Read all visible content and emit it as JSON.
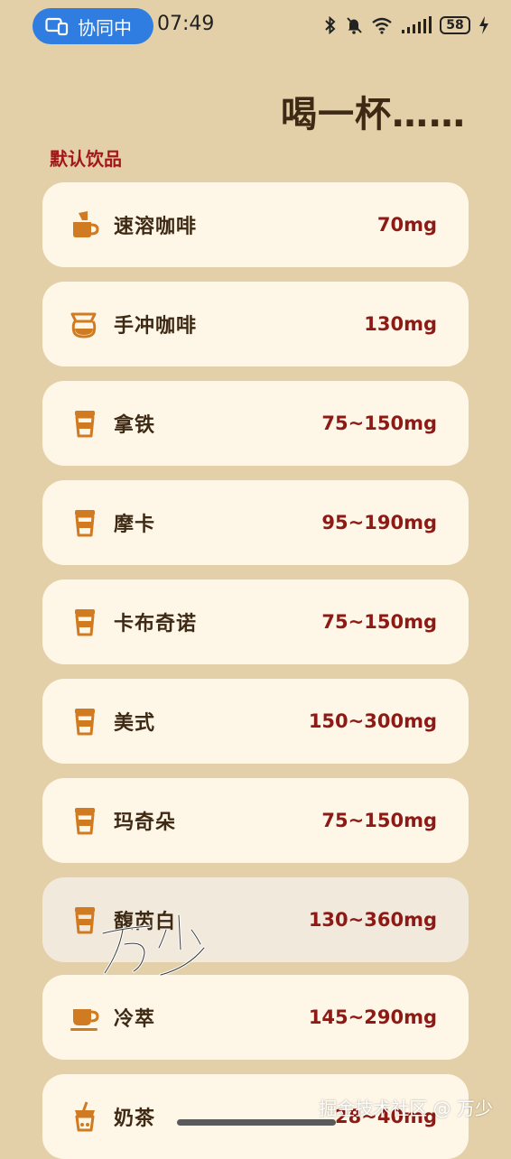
{
  "status_bar": {
    "collab_label": "协同中",
    "time": "07:49",
    "battery": "58"
  },
  "header": {
    "title": "喝一杯……",
    "section_label": "默认饮品"
  },
  "drinks": [
    {
      "name": "速溶咖啡",
      "caffeine": "70mg",
      "icon": "instant-coffee-icon"
    },
    {
      "name": "手冲咖啡",
      "caffeine": "130mg",
      "icon": "pour-over-icon"
    },
    {
      "name": "拿铁",
      "caffeine": "75~150mg",
      "icon": "coffee-cup-icon"
    },
    {
      "name": "摩卡",
      "caffeine": "95~190mg",
      "icon": "coffee-cup-icon"
    },
    {
      "name": "卡布奇诺",
      "caffeine": "75~150mg",
      "icon": "coffee-cup-icon"
    },
    {
      "name": "美式",
      "caffeine": "150~300mg",
      "icon": "coffee-cup-icon"
    },
    {
      "name": "玛奇朵",
      "caffeine": "75~150mg",
      "icon": "coffee-cup-icon"
    },
    {
      "name": "馥芮白",
      "caffeine": "130~360mg",
      "icon": "coffee-cup-icon"
    },
    {
      "name": "冷萃",
      "caffeine": "145~290mg",
      "icon": "cold-brew-mug-icon"
    },
    {
      "name": "奶茶",
      "caffeine": "28~40mg",
      "icon": "milk-tea-icon"
    }
  ],
  "watermark": {
    "signature_text": "万少",
    "footer": "掘金技术社区 @ 万少"
  },
  "colors": {
    "background": "#e3d0a8",
    "card": "#fef6e6",
    "accent_icon": "#d07a22",
    "dose_text": "#8e1a16",
    "section_label": "#a3171a",
    "collab_pill": "#2f7de1"
  }
}
